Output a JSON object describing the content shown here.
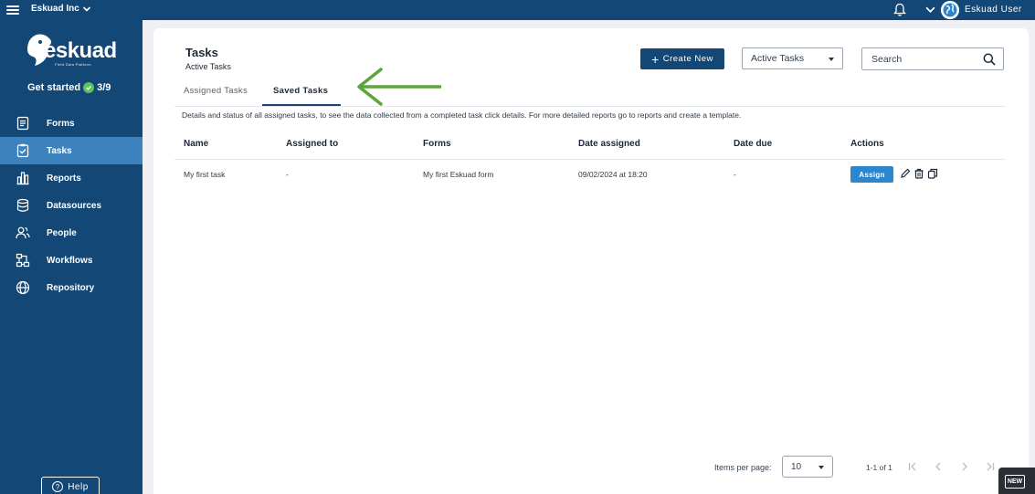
{
  "topbar": {
    "org_name": "Eskuad Inc",
    "user_name": "Eskuad User"
  },
  "sidebar": {
    "logo_text": "eskuad",
    "logo_tagline": "Field Data Platform",
    "get_started_label": "Get started",
    "get_started_progress": "3/9",
    "items": [
      {
        "label": "Forms",
        "icon": "form-icon",
        "active": false
      },
      {
        "label": "Tasks",
        "icon": "task-check-icon",
        "active": true
      },
      {
        "label": "Reports",
        "icon": "chart-icon",
        "active": false
      },
      {
        "label": "Datasources",
        "icon": "database-icon",
        "active": false
      },
      {
        "label": "People",
        "icon": "people-icon",
        "active": false
      },
      {
        "label": "Workflows",
        "icon": "workflow-icon",
        "active": false
      },
      {
        "label": "Repository",
        "icon": "globe-icon",
        "active": false
      }
    ],
    "help_label": "Help"
  },
  "main": {
    "title": "Tasks",
    "subtitle": "Active Tasks",
    "create_label": "Create New",
    "filter_selected": "Active Tasks",
    "search_placeholder": "Search",
    "tabs": [
      {
        "label": "Assigned Tasks",
        "active": false
      },
      {
        "label": "Saved Tasks",
        "active": true
      }
    ],
    "description": "Details and status of all assigned tasks, to see the data collected from a completed task click details. For more detailed reports go to reports and create a template.",
    "table": {
      "headers": [
        "Name",
        "Assigned to",
        "Forms",
        "Date assigned",
        "Date due",
        "Actions"
      ],
      "rows": [
        {
          "name": "My first task",
          "assigned_to": "-",
          "form": "My first Eskuad form",
          "date_assigned": "09/02/2024 at 18:20",
          "date_due": "-",
          "action_label": "Assign"
        }
      ]
    },
    "pagination": {
      "items_per_page_label": "Items per page:",
      "items_per_page": "10",
      "range": "1-1 of 1"
    }
  },
  "badge": {
    "label": "NEW"
  },
  "colors": {
    "navy": "#134776",
    "sidebar_active": "#3e82bd",
    "assign_blue": "#2a86cf",
    "arrow_green": "#5aa63a"
  }
}
